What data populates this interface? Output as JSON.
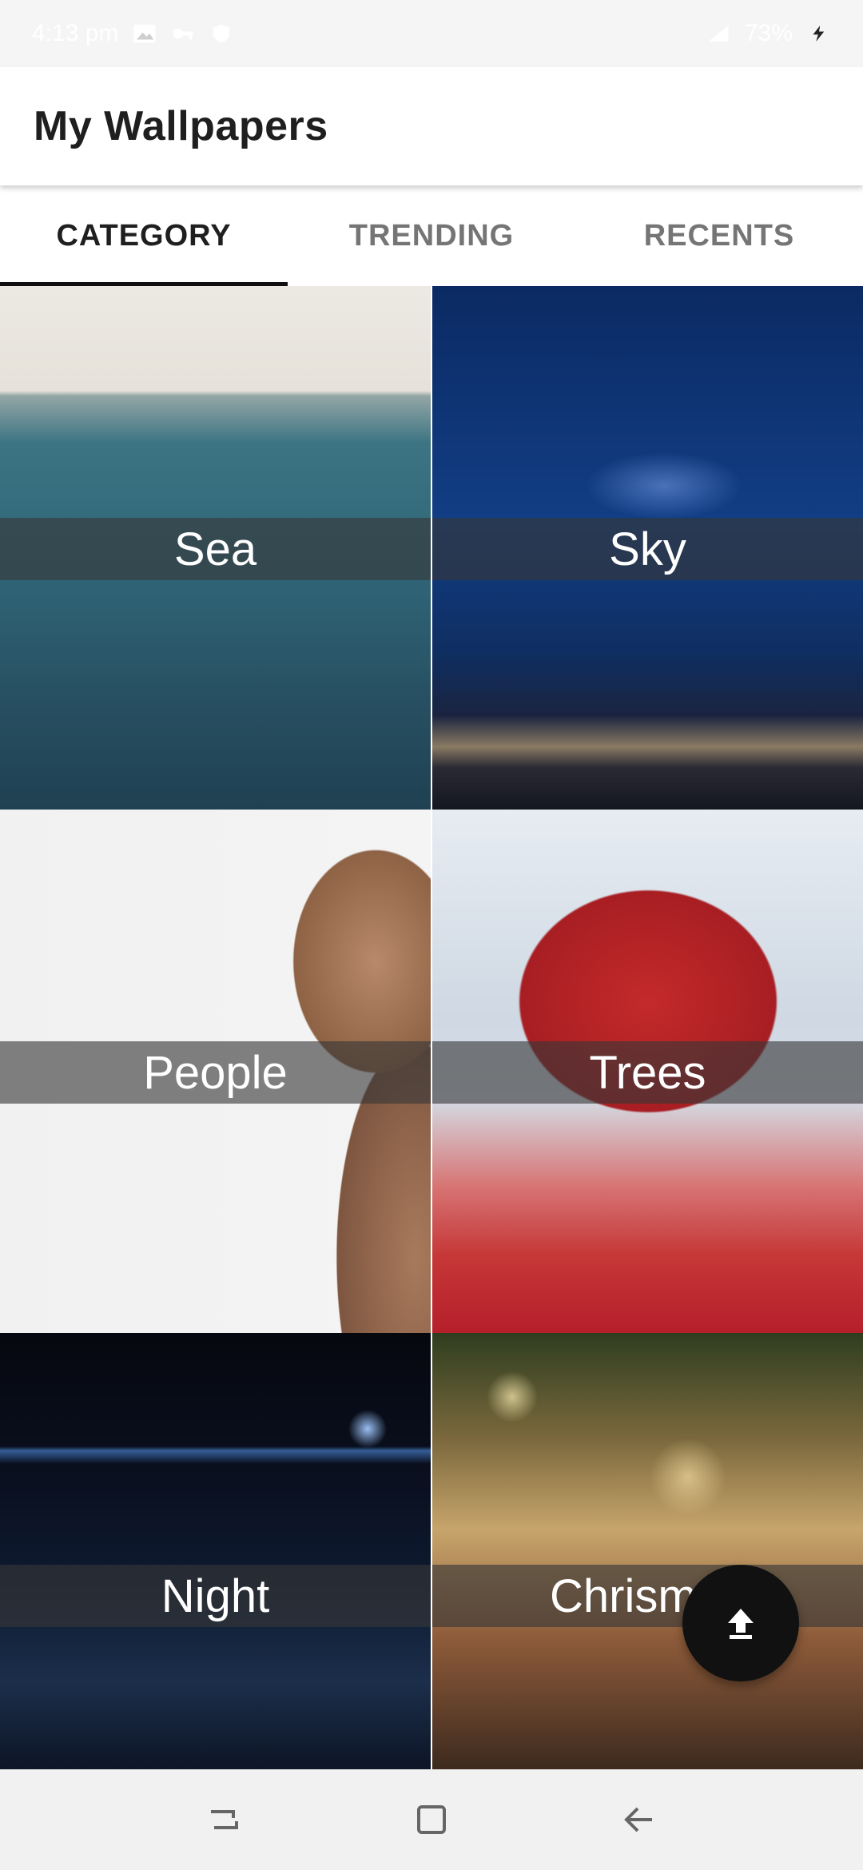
{
  "status_bar": {
    "time": "4:13 pm",
    "battery": "73%",
    "signal_label": "Signal"
  },
  "app_bar": {
    "title": "My Wallpapers"
  },
  "tabs": [
    {
      "label": "CATEGORY",
      "active": true
    },
    {
      "label": "TRENDING",
      "active": false
    },
    {
      "label": "RECENTS",
      "active": false
    }
  ],
  "categories": [
    {
      "label": "Sea"
    },
    {
      "label": "Sky"
    },
    {
      "label": "People"
    },
    {
      "label": "Trees"
    },
    {
      "label": "Night"
    },
    {
      "label": "Chrismas"
    }
  ],
  "fab": {
    "icon": "upload-icon"
  },
  "nav": {
    "recents_icon": "recents-icon",
    "home_icon": "home-icon",
    "back_icon": "back-icon"
  },
  "colors": {
    "accent": "#111111",
    "tab_inactive": "#757575",
    "label_overlay": "rgba(55,55,55,0.62)"
  }
}
